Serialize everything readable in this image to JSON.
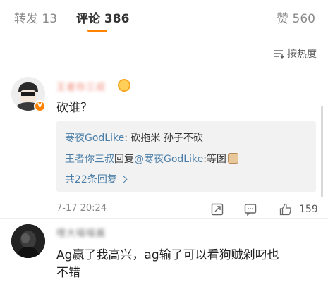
{
  "tabs": {
    "repost": "转发 13",
    "comment": "评论 386",
    "like": "赞 560"
  },
  "sort": {
    "label": "按热度"
  },
  "comments": [
    {
      "username": "王者你三叔",
      "text": "砍谁？",
      "replies": [
        {
          "author": "寒夜GodLike",
          "text": ": 砍拖米 孙子不砍"
        },
        {
          "author": "王者你三叔",
          "action": "回复",
          "mention": "@寒夜GodLike",
          "text": ":等图"
        }
      ],
      "more_replies": "共22条回复",
      "time": "7-17 20:24",
      "likes": "159"
    },
    {
      "username": "哩大喵喵酱",
      "text_line1": "Ag赢了我高兴，ag输了可以看狗贼剁叼也",
      "text_line2": "不错"
    }
  ],
  "colors": {
    "accent": "#ff8200",
    "link": "#4a7ea8",
    "muted": "#8a8a8a"
  },
  "icons": [
    "sort-icon",
    "verified-badge-icon",
    "medal-icon",
    "dog-emoji-icon",
    "chevron-right-icon",
    "share-icon",
    "comment-icon",
    "thumbs-up-icon"
  ]
}
